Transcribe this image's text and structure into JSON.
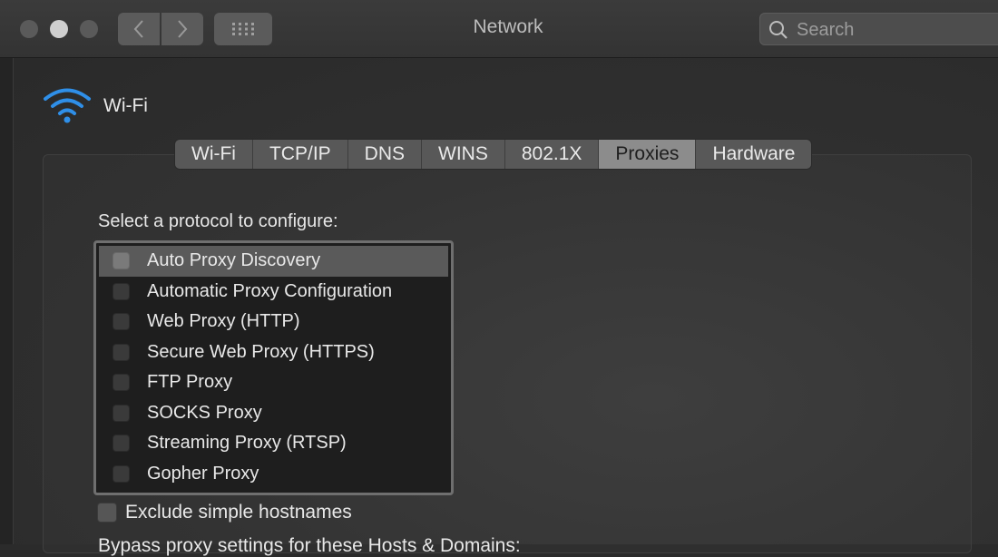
{
  "window": {
    "title": "Network"
  },
  "search": {
    "placeholder": "Search"
  },
  "interface": {
    "name": "Wi-Fi",
    "icon": "wifi-icon",
    "icon_color": "#2f8fe8"
  },
  "tabs": [
    {
      "label": "Wi-Fi",
      "selected": false
    },
    {
      "label": "TCP/IP",
      "selected": false
    },
    {
      "label": "DNS",
      "selected": false
    },
    {
      "label": "WINS",
      "selected": false
    },
    {
      "label": "802.1X",
      "selected": false
    },
    {
      "label": "Proxies",
      "selected": true
    },
    {
      "label": "Hardware",
      "selected": false
    }
  ],
  "protocols": {
    "label": "Select a protocol to configure:",
    "items": [
      {
        "label": "Auto Proxy Discovery",
        "checked": false,
        "selected": true
      },
      {
        "label": "Automatic Proxy Configuration",
        "checked": false,
        "selected": false
      },
      {
        "label": "Web Proxy (HTTP)",
        "checked": false,
        "selected": false
      },
      {
        "label": "Secure Web Proxy (HTTPS)",
        "checked": false,
        "selected": false
      },
      {
        "label": "FTP Proxy",
        "checked": false,
        "selected": false
      },
      {
        "label": "SOCKS Proxy",
        "checked": false,
        "selected": false
      },
      {
        "label": "Streaming Proxy (RTSP)",
        "checked": false,
        "selected": false
      },
      {
        "label": "Gopher Proxy",
        "checked": false,
        "selected": false
      }
    ]
  },
  "exclude_simple_hostnames": {
    "label": "Exclude simple hostnames",
    "checked": false
  },
  "bypass": {
    "label": "Bypass proxy settings for these Hosts & Domains:"
  }
}
